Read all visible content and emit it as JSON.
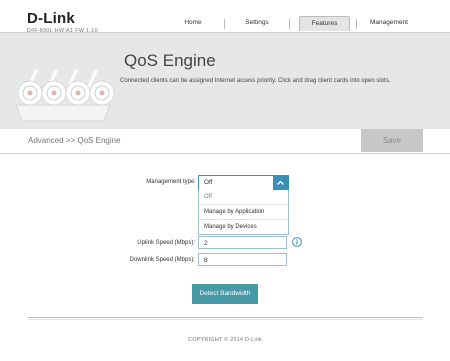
{
  "header": {
    "logo_text": "D-Link",
    "model_info": "DIR-890L   HW:A1   FW:1.10",
    "nav": [
      {
        "label": "Home",
        "active": false
      },
      {
        "label": "Settings",
        "active": false
      },
      {
        "label": "Features",
        "active": true
      },
      {
        "label": "Management",
        "active": false
      }
    ]
  },
  "banner": {
    "title": "QoS Engine",
    "description": "Connected clients can be assigned Internet access priority. Click and drag client cards into open slots.",
    "art_icon": "router-illustration"
  },
  "breadcrumb": {
    "text": "Advanced >> QoS Engine",
    "save_label": "Save"
  },
  "form": {
    "management_type_label": "Management type:",
    "management_type_value": "Off",
    "management_type_options": [
      "Off",
      "Manage by Application",
      "Manage by Devices"
    ],
    "uplink_label": "Uplink Speed (Mbps):",
    "uplink_value": "2",
    "downlink_label": "Downlink Speed (Mbps):",
    "downlink_value": "8",
    "info_icon": "info-icon",
    "detect_label": "Detect Bandwidth"
  },
  "footer": {
    "copyright": "COPYRIGHT © 2014 D-Link"
  },
  "colors": {
    "accent": "#3a8fb5",
    "button_teal": "#4799a6",
    "banner_bg": "#e6e7e8",
    "save_disabled": "#c8c8c8"
  }
}
